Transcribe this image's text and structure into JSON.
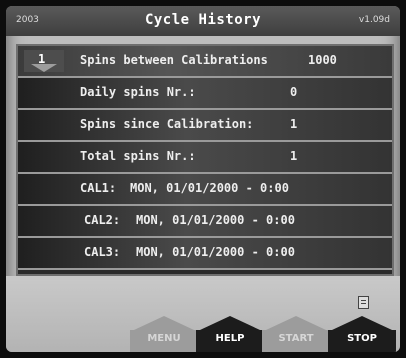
{
  "titlebar": {
    "left": "2003",
    "title": "Cycle History",
    "version": "v1.09d"
  },
  "rows": [
    {
      "label": "Spins between Calibrations",
      "value": "1000",
      "page": "1"
    },
    {
      "label": "Daily spins Nr.:",
      "value": "0"
    },
    {
      "label": "Spins since Calibration:",
      "value": "1"
    },
    {
      "label": "Total spins Nr.:",
      "value": "1"
    },
    {
      "label": "CAL1:",
      "value": "MON, 01/01/2000 - 0:00"
    },
    {
      "label": "CAL2:",
      "value": "MON, 01/01/2000 - 0:00"
    },
    {
      "label": "CAL3:",
      "value": "MON, 01/01/2000 - 0:00"
    }
  ],
  "softkeys": {
    "menu": "MENU",
    "help": "HELP",
    "start": "START",
    "stop": "STOP"
  },
  "icons": {
    "status": "document-icon",
    "page_arrow": "down-arrow-icon"
  }
}
